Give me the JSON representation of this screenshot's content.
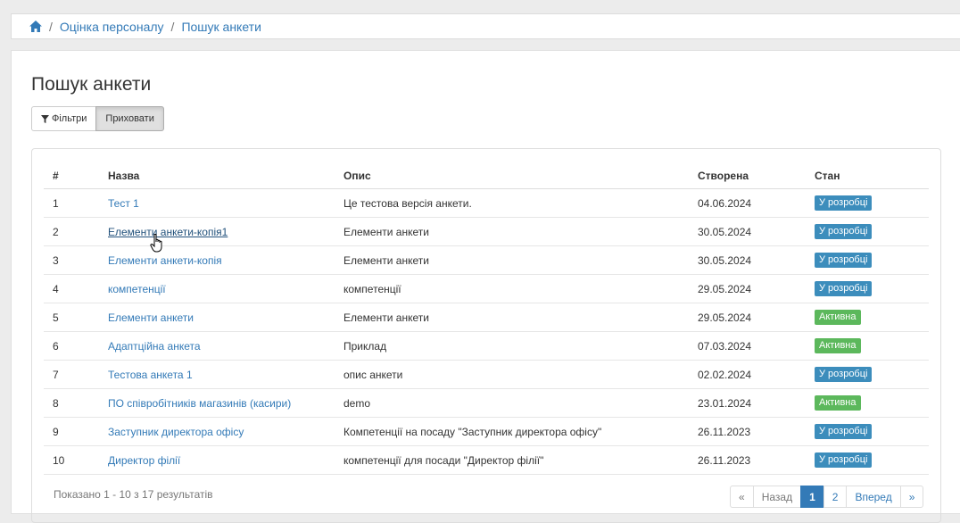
{
  "breadcrumb": {
    "home_icon": "home-icon",
    "items": [
      "Оцінка персоналу",
      "Пошук анкети"
    ]
  },
  "page": {
    "title": "Пошук анкети",
    "filters_label": "Фільтри",
    "hide_label": "Приховати"
  },
  "table": {
    "headers": [
      "#",
      "Назва",
      "Опис",
      "Створена",
      "Стан"
    ],
    "rows": [
      {
        "num": "1",
        "name": "Тест 1",
        "desc": "Це тестова версія анкети.",
        "created": "04.06.2024",
        "status": "У розробці",
        "status_type": "dev"
      },
      {
        "num": "2",
        "name": "Елементи анкети-копія1",
        "desc": "Елементи анкети",
        "created": "30.05.2024",
        "status": "У розробці",
        "status_type": "dev"
      },
      {
        "num": "3",
        "name": "Елементи анкети-копія",
        "desc": "Елементи анкети",
        "created": "30.05.2024",
        "status": "У розробці",
        "status_type": "dev"
      },
      {
        "num": "4",
        "name": "компетенції",
        "desc": "компетенції",
        "created": "29.05.2024",
        "status": "У розробці",
        "status_type": "dev"
      },
      {
        "num": "5",
        "name": "Елементи анкети",
        "desc": "Елементи анкети",
        "created": "29.05.2024",
        "status": "Активна",
        "status_type": "active"
      },
      {
        "num": "6",
        "name": "Адаптційна анкета",
        "desc": "Приклад",
        "created": "07.03.2024",
        "status": "Активна",
        "status_type": "active"
      },
      {
        "num": "7",
        "name": "Тестова анкета 1",
        "desc": "опис анкети",
        "created": "02.02.2024",
        "status": "У розробці",
        "status_type": "dev"
      },
      {
        "num": "8",
        "name": "ПО співробітників магазинів (касири)",
        "desc": "demo",
        "created": "23.01.2024",
        "status": "Активна",
        "status_type": "active"
      },
      {
        "num": "9",
        "name": "Заступник директора офісу",
        "desc": "Компетенції на посаду \"Заступник директора офісу\"",
        "created": "26.11.2023",
        "status": "У розробці",
        "status_type": "dev"
      },
      {
        "num": "10",
        "name": "Директор філії",
        "desc": "компетенції для посади \"Директор філії\"",
        "created": "26.11.2023",
        "status": "У розробці",
        "status_type": "dev"
      }
    ]
  },
  "summary": "Показано 1 - 10 з 17 результатів",
  "pager": {
    "first": "«",
    "prev": "Назад",
    "pages": [
      "1",
      "2"
    ],
    "current": "1",
    "next": "Вперед",
    "last": "»"
  },
  "colors": {
    "link": "#337ab7",
    "dev_badge": "#3c8dbc",
    "active_badge": "#5cb85c"
  }
}
